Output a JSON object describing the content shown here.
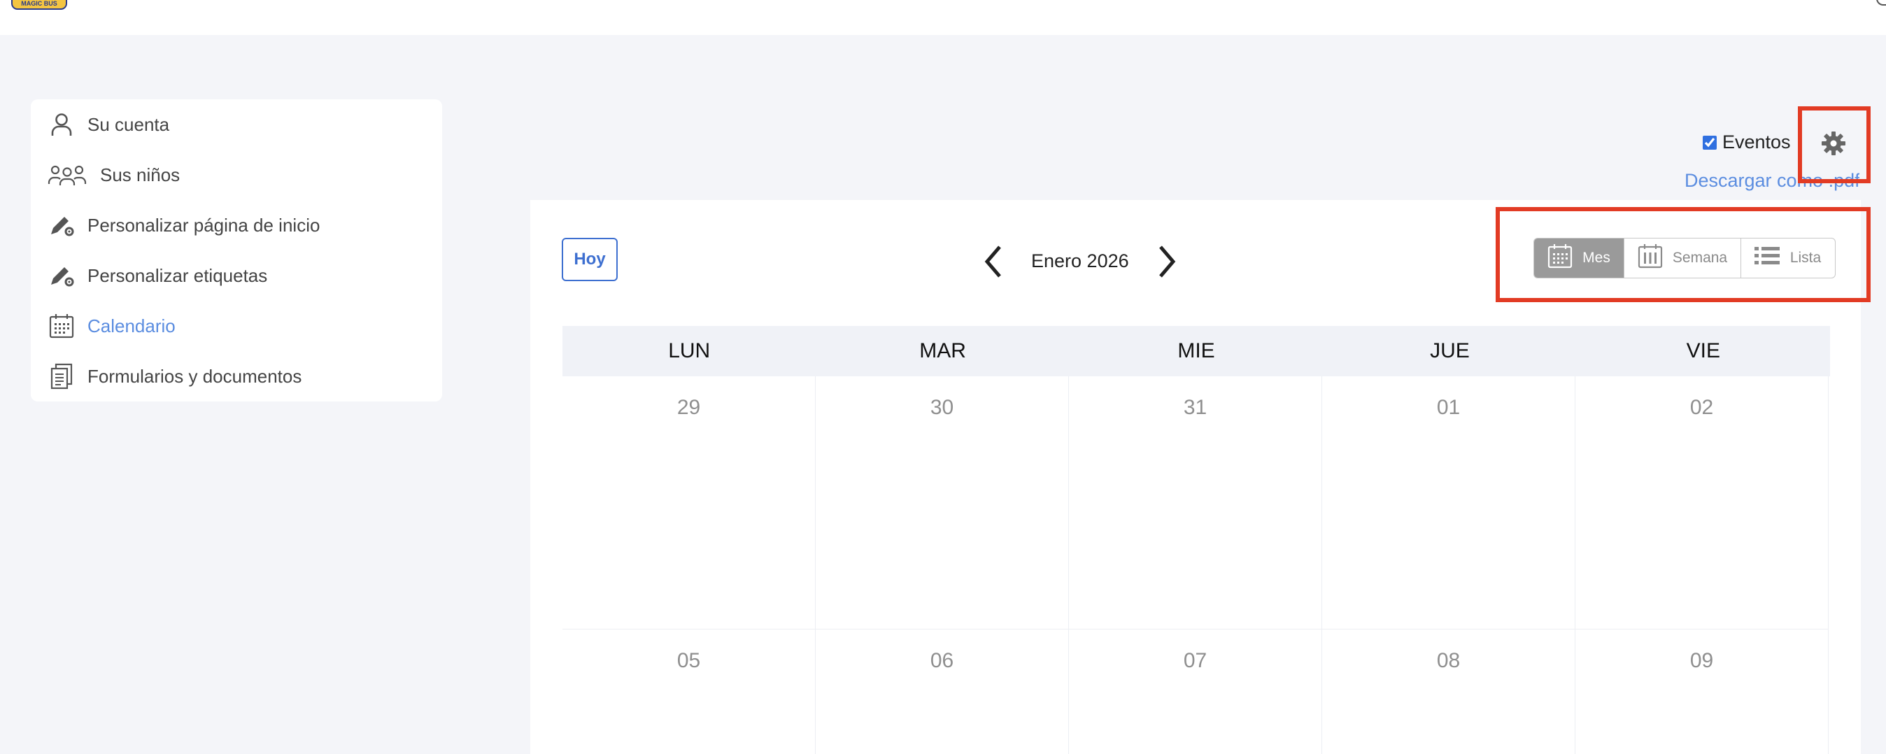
{
  "header": {
    "logo_text": "MAGIC BUS"
  },
  "sidebar": {
    "items": [
      {
        "label": "Su cuenta",
        "icon": "user-icon"
      },
      {
        "label": "Sus niños",
        "icon": "users-group-icon"
      },
      {
        "label": "Personalizar página de inicio",
        "icon": "edit-settings-icon"
      },
      {
        "label": "Personalizar etiquetas",
        "icon": "edit-settings-icon"
      },
      {
        "label": "Calendario",
        "icon": "calendar-icon",
        "active": true
      },
      {
        "label": "Formularios y documentos",
        "icon": "documents-icon"
      }
    ]
  },
  "settings": {
    "events_label": "Eventos",
    "events_checked": true,
    "gear_icon": "gear-icon",
    "download_link": "Descargar como .pdf"
  },
  "calendar": {
    "today_button": "Hoy",
    "month_title": "Enero 2026",
    "views": [
      {
        "label": "Mes",
        "icon": "calendar-month-icon",
        "active": true
      },
      {
        "label": "Semana",
        "icon": "calendar-week-icon",
        "active": false
      },
      {
        "label": "Lista",
        "icon": "list-icon",
        "active": false
      }
    ],
    "weekdays": [
      "LUN",
      "MAR",
      "MIE",
      "JUE",
      "VIE"
    ],
    "weeks": [
      [
        "29",
        "30",
        "31",
        "01",
        "02"
      ],
      [
        "05",
        "06",
        "07",
        "08",
        "09"
      ]
    ]
  },
  "colors": {
    "accent": "#5b8de0",
    "highlight": "#e23b24",
    "active_view_bg": "#9a9a9a"
  }
}
